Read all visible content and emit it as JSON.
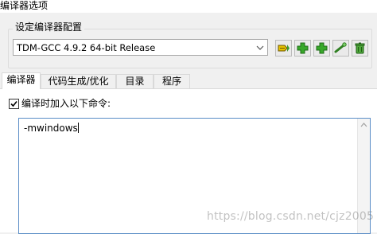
{
  "window": {
    "title": "编译器选项"
  },
  "group": {
    "label": "设定编译器配置",
    "selected_profile": "TDM-GCC 4.9.2 64-bit Release",
    "buttons": [
      {
        "name": "rename-profile-button",
        "icon": "rename-icon"
      },
      {
        "name": "add-profile-button",
        "icon": "plus-icon"
      },
      {
        "name": "add-empty-profile-button",
        "icon": "plus-icon"
      },
      {
        "name": "find-compiler-button",
        "icon": "wand-icon"
      },
      {
        "name": "delete-profile-button",
        "icon": "trash-icon"
      }
    ]
  },
  "tabs": [
    {
      "label": "编译器",
      "active": true
    },
    {
      "label": "代码生成/优化",
      "active": false
    },
    {
      "label": "目录",
      "active": false
    },
    {
      "label": "程序",
      "active": false
    }
  ],
  "compiler_tab": {
    "checkbox_label": "编译时加入以下命令:",
    "checkbox_checked": true,
    "commands": "-mwindows"
  },
  "watermark": "https://blog.csdn.net/cjz2005"
}
